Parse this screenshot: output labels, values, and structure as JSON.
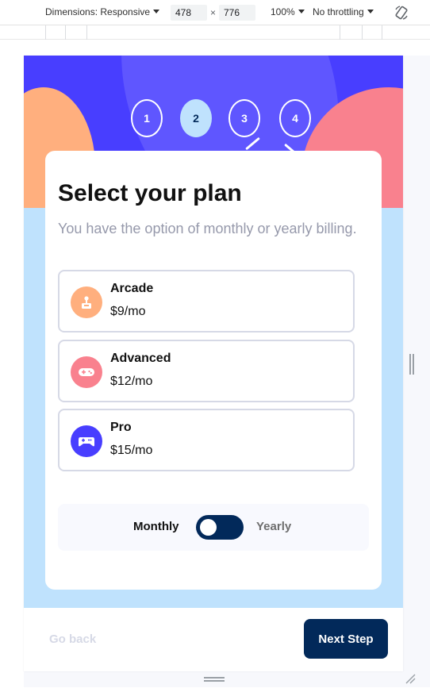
{
  "devtools": {
    "dimensions_label": "Dimensions: Responsive",
    "width_value": "478",
    "height_value": "776",
    "times": "×",
    "zoom": "100%",
    "throttling": "No throttling",
    "rotate_icon": "rotate-icon"
  },
  "steps": [
    {
      "number": "1"
    },
    {
      "number": "2",
      "active": true
    },
    {
      "number": "3"
    },
    {
      "number": "4"
    }
  ],
  "card": {
    "title": "Select your plan",
    "subtitle": "You have the option of monthly or yearly billing."
  },
  "plans": [
    {
      "name": "Arcade",
      "price": "$9/mo",
      "icon": "arcade-icon",
      "color": "#ffaf7e"
    },
    {
      "name": "Advanced",
      "price": "$12/mo",
      "icon": "gamepad-icon",
      "color": "#f9818e"
    },
    {
      "name": "Pro",
      "price": "$15/mo",
      "icon": "controller-icon",
      "color": "#483eff"
    }
  ],
  "billing": {
    "monthly_label": "Monthly",
    "yearly_label": "Yearly",
    "selected": "Monthly"
  },
  "footer": {
    "back_label": "Go back",
    "next_label": "Next Step"
  },
  "colors": {
    "primary": "#02295a",
    "accent": "#483eff",
    "light_blue": "#bfe2fd",
    "border": "#d6d9e6",
    "muted": "#9699ab"
  }
}
